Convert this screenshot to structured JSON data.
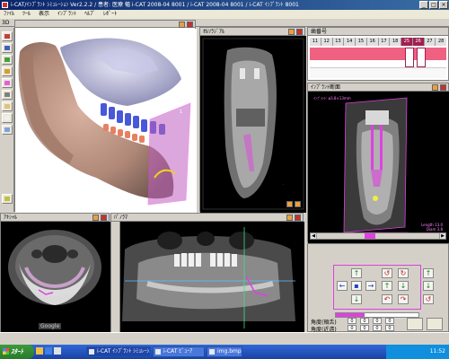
{
  "window": {
    "title": "i-CAT/ｲﾝﾌﾟﾗﾝﾄ ｼﾐｭﾚｰｼｮﾝ Ver2.2.2 / 患者: 医療 幅 i-CAT 2008-04 8001 / i-CAT 2008-04 8001 / i-CAT ｲﾝﾌﾟﾗﾝﾄ 8001",
    "minimize": "_",
    "maximize": "□",
    "close": "×"
  },
  "menu": [
    "ﾌｧｲﾙ",
    "ﾂｰﾙ",
    "表示",
    "ｲﾝﾌﾟﾗﾝﾄ",
    "ﾍﾙﾌﾟ",
    "ﾚﾎﾟｰﾄ"
  ],
  "panels": {
    "three_d": {
      "title": "3D"
    },
    "sagittal": {
      "title": "ｵﾙｿﾗｼﾞｱﾙ"
    },
    "timeline": {
      "title": "歯番号",
      "numbers": [
        "11",
        "12",
        "13",
        "14",
        "15",
        "16",
        "17",
        "18",
        "25",
        "26",
        "27",
        "28"
      ]
    },
    "implant": {
      "title": "ｲﾝﾌﾟﾗﾝﾄ断面",
      "overlay_text": "ｲﾝﾌﾟﾗﾝﾄ: ø3.8×13mm",
      "scale": [
        "Length 13.0",
        "Diam 3.8"
      ]
    },
    "axial": {
      "title": "ｱｷｼｬﾙ",
      "watermark": "Google"
    },
    "panoramic": {
      "title": "ﾊﾟﾉﾗﾏ"
    }
  },
  "controls": {
    "rows": [
      {
        "label": "角度(頬舌)",
        "values": [
          "0",
          "0",
          "0",
          "0"
        ]
      },
      {
        "label": "角度(近遠)",
        "values": [
          "0",
          "0",
          "0",
          "0"
        ]
      }
    ],
    "slider_fraction": 0.35
  },
  "taskbar": {
    "start": "ｽﾀｰﾄ",
    "tasks": [
      "i-CAT ｲﾝﾌﾟﾗﾝﾄ ｼﾐｭﾚｰｼｮﾝ",
      "i-CAT ﾋﾞｭｰｱ",
      "img.bmp"
    ],
    "clock": "11:52"
  },
  "colors": {
    "magenta": "#e040e0",
    "pink_band": "#f06080",
    "title_blue": "#0a246a"
  }
}
